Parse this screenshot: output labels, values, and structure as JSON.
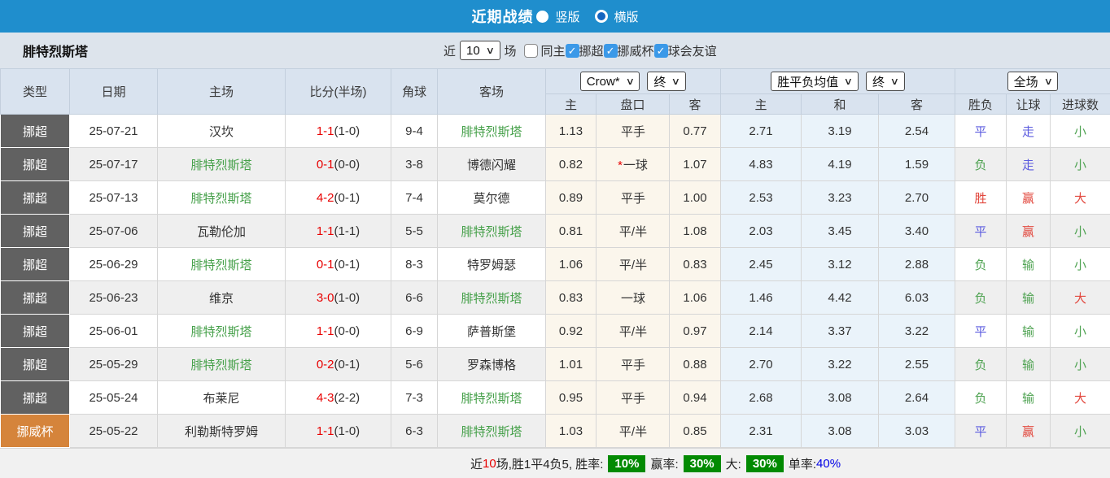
{
  "topbar": {
    "title": "近期战绩",
    "radios": [
      {
        "label": "竖版",
        "selected": true
      },
      {
        "label": "横版",
        "selected": false
      }
    ]
  },
  "filter": {
    "team": "腓特烈斯塔",
    "recent_label": "近",
    "count_select": "10",
    "matches_label": "场",
    "checkboxes": [
      {
        "label": "同主",
        "checked": false
      },
      {
        "label": "挪超",
        "checked": true
      },
      {
        "label": "挪威杯",
        "checked": true
      },
      {
        "label": "球会友谊",
        "checked": true
      }
    ]
  },
  "table": {
    "columns": [
      "类型",
      "日期",
      "主场",
      "比分(半场)",
      "角球",
      "客场"
    ],
    "odds_group1": {
      "select1": "Crow*",
      "select2": "终",
      "subcols": [
        "主",
        "盘口",
        "客"
      ]
    },
    "odds_group2": {
      "select1": "胜平负均值",
      "select2": "终",
      "subcols": [
        "主",
        "和",
        "客"
      ]
    },
    "result_group": {
      "select": "全场",
      "subcols": [
        "胜负",
        "让球",
        "进球数"
      ]
    },
    "rows": [
      {
        "type": "挪超",
        "type_class": "league",
        "date": "25-07-21",
        "home": "汉坎",
        "home_c": "",
        "score": "1-1",
        "half": "(1-0)",
        "corner": "9-4",
        "away": "腓特烈斯塔",
        "away_c": "self",
        "o1h": "1.13",
        "o1star": "",
        "o1line": "平手",
        "o1a": "0.77",
        "o2h": "2.71",
        "o2d": "3.19",
        "o2a": "2.54",
        "wdl": "平",
        "wdl_c": "blue",
        "ag": "走",
        "ag_c": "blue",
        "ou": "小",
        "ou_c": "green"
      },
      {
        "type": "挪超",
        "type_class": "league",
        "date": "25-07-17",
        "home": "腓特烈斯塔",
        "home_c": "self",
        "score": "0-1",
        "half": "(0-0)",
        "corner": "3-8",
        "away": "博德闪耀",
        "away_c": "",
        "o1h": "0.82",
        "o1star": "*",
        "o1line": "一球",
        "o1a": "1.07",
        "o2h": "4.83",
        "o2d": "4.19",
        "o2a": "1.59",
        "wdl": "负",
        "wdl_c": "green",
        "ag": "走",
        "ag_c": "blue",
        "ou": "小",
        "ou_c": "green"
      },
      {
        "type": "挪超",
        "type_class": "league",
        "date": "25-07-13",
        "home": "腓特烈斯塔",
        "home_c": "self",
        "score": "4-2",
        "half": "(0-1)",
        "corner": "7-4",
        "away": "莫尔德",
        "away_c": "",
        "o1h": "0.89",
        "o1star": "",
        "o1line": "平手",
        "o1a": "1.00",
        "o2h": "2.53",
        "o2d": "3.23",
        "o2a": "2.70",
        "wdl": "胜",
        "wdl_c": "red",
        "ag": "赢",
        "ag_c": "red",
        "ou": "大",
        "ou_c": "red"
      },
      {
        "type": "挪超",
        "type_class": "league",
        "date": "25-07-06",
        "home": "瓦勒伦加",
        "home_c": "",
        "score": "1-1",
        "half": "(1-1)",
        "corner": "5-5",
        "away": "腓特烈斯塔",
        "away_c": "self",
        "o1h": "0.81",
        "o1star": "",
        "o1line": "平/半",
        "o1a": "1.08",
        "o2h": "2.03",
        "o2d": "3.45",
        "o2a": "3.40",
        "wdl": "平",
        "wdl_c": "blue",
        "ag": "赢",
        "ag_c": "red",
        "ou": "小",
        "ou_c": "green"
      },
      {
        "type": "挪超",
        "type_class": "league",
        "date": "25-06-29",
        "home": "腓特烈斯塔",
        "home_c": "self",
        "score": "0-1",
        "half": "(0-1)",
        "corner": "8-3",
        "away": "特罗姆瑟",
        "away_c": "",
        "o1h": "1.06",
        "o1star": "",
        "o1line": "平/半",
        "o1a": "0.83",
        "o2h": "2.45",
        "o2d": "3.12",
        "o2a": "2.88",
        "wdl": "负",
        "wdl_c": "green",
        "ag": "输",
        "ag_c": "green",
        "ou": "小",
        "ou_c": "green"
      },
      {
        "type": "挪超",
        "type_class": "league",
        "date": "25-06-23",
        "home": "维京",
        "home_c": "",
        "score": "3-0",
        "half": "(1-0)",
        "corner": "6-6",
        "away": "腓特烈斯塔",
        "away_c": "self",
        "o1h": "0.83",
        "o1star": "",
        "o1line": "一球",
        "o1a": "1.06",
        "o2h": "1.46",
        "o2d": "4.42",
        "o2a": "6.03",
        "wdl": "负",
        "wdl_c": "green",
        "ag": "输",
        "ag_c": "green",
        "ou": "大",
        "ou_c": "red"
      },
      {
        "type": "挪超",
        "type_class": "league",
        "date": "25-06-01",
        "home": "腓特烈斯塔",
        "home_c": "self",
        "score": "1-1",
        "half": "(0-0)",
        "corner": "6-9",
        "away": "萨普斯堡",
        "away_c": "",
        "o1h": "0.92",
        "o1star": "",
        "o1line": "平/半",
        "o1a": "0.97",
        "o2h": "2.14",
        "o2d": "3.37",
        "o2a": "3.22",
        "wdl": "平",
        "wdl_c": "blue",
        "ag": "输",
        "ag_c": "green",
        "ou": "小",
        "ou_c": "green"
      },
      {
        "type": "挪超",
        "type_class": "league",
        "date": "25-05-29",
        "home": "腓特烈斯塔",
        "home_c": "self",
        "score": "0-2",
        "half": "(0-1)",
        "corner": "5-6",
        "away": "罗森博格",
        "away_c": "",
        "o1h": "1.01",
        "o1star": "",
        "o1line": "平手",
        "o1a": "0.88",
        "o2h": "2.70",
        "o2d": "3.22",
        "o2a": "2.55",
        "wdl": "负",
        "wdl_c": "green",
        "ag": "输",
        "ag_c": "green",
        "ou": "小",
        "ou_c": "green"
      },
      {
        "type": "挪超",
        "type_class": "league",
        "date": "25-05-24",
        "home": "布莱尼",
        "home_c": "",
        "score": "4-3",
        "half": "(2-2)",
        "corner": "7-3",
        "away": "腓特烈斯塔",
        "away_c": "self",
        "o1h": "0.95",
        "o1star": "",
        "o1line": "平手",
        "o1a": "0.94",
        "o2h": "2.68",
        "o2d": "3.08",
        "o2a": "2.64",
        "wdl": "负",
        "wdl_c": "green",
        "ag": "输",
        "ag_c": "green",
        "ou": "大",
        "ou_c": "red"
      },
      {
        "type": "挪威杯",
        "type_class": "cup",
        "date": "25-05-22",
        "home": "利勒斯特罗姆",
        "home_c": "",
        "score": "1-1",
        "half": "(1-0)",
        "corner": "6-3",
        "away": "腓特烈斯塔",
        "away_c": "self",
        "o1h": "1.03",
        "o1star": "",
        "o1line": "平/半",
        "o1a": "0.85",
        "o2h": "2.31",
        "o2d": "3.08",
        "o2a": "3.03",
        "wdl": "平",
        "wdl_c": "blue",
        "ag": "赢",
        "ag_c": "red",
        "ou": "小",
        "ou_c": "green"
      }
    ]
  },
  "summary": {
    "seg1": "近",
    "n": "10",
    "seg2": "场,胜1平4负5, 胜率:",
    "win_rate": "10%",
    "l2": "赢率:",
    "win_odds_rate": "30%",
    "l3": "大:",
    "big_rate": "30%",
    "l4": "单率:",
    "single_rate": "40%"
  },
  "colors": {
    "topbar_blue": "#1f8ecd",
    "checkbox_blue": "#3b99e8",
    "badge_green": "#028a02",
    "win_red": "#e2483e",
    "draw_blue": "#5b5bdf",
    "lose_green": "#4fa352",
    "team_green": "#45a049",
    "league_type_bg": "#616161",
    "cup_type_bg": "#d5843b",
    "header_bg": "#d9e3ef",
    "zebra_gray": "#efefef",
    "ah_col_bg": "#fbf6ec",
    "avg_col_bg": "#eaf3fa"
  }
}
